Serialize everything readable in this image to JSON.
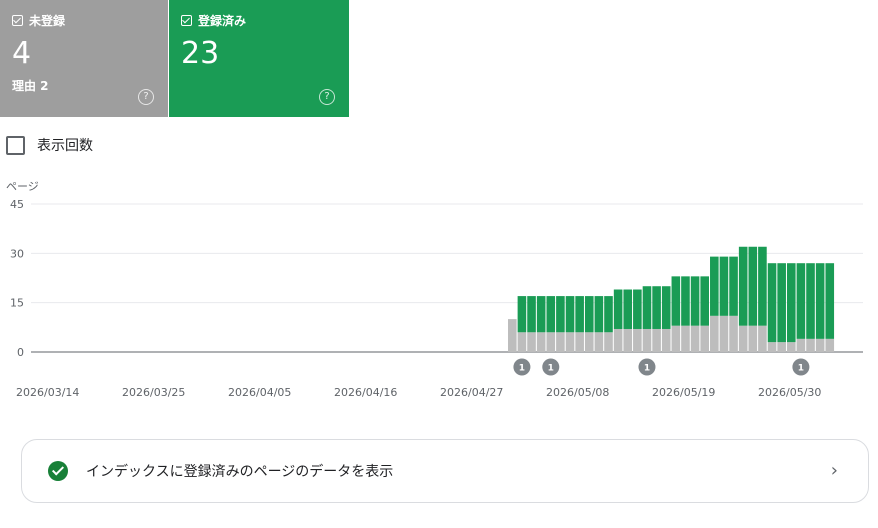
{
  "cards": {
    "unindexed": {
      "label": "未登録",
      "value": "4",
      "sub": "理由 2",
      "help": "?"
    },
    "indexed": {
      "label": "登録済み",
      "value": "23",
      "help": "?"
    }
  },
  "impressions_toggle": {
    "label": "表示回数"
  },
  "chart_data": {
    "type": "bar",
    "ylabel": "ページ",
    "y_ticks": [
      "45",
      "30",
      "15",
      "0"
    ],
    "ylim": [
      0,
      45
    ],
    "x_tick_labels": [
      "2026/03/14",
      "2026/03/25",
      "2026/04/05",
      "2026/04/16",
      "2026/04/27",
      "2026/05/08",
      "2026/05/19",
      "2026/05/30"
    ],
    "start_date": "2026/03/14",
    "series": [
      {
        "name": "未登録",
        "color": "#bdbdbd",
        "values": [
          0,
          0,
          0,
          0,
          0,
          0,
          0,
          0,
          0,
          0,
          0,
          0,
          0,
          0,
          0,
          0,
          0,
          0,
          0,
          0,
          0,
          0,
          0,
          0,
          0,
          0,
          0,
          0,
          0,
          0,
          0,
          0,
          0,
          0,
          0,
          0,
          0,
          0,
          0,
          0,
          0,
          0,
          0,
          0,
          0,
          0,
          0,
          0,
          0,
          10,
          6,
          6,
          6,
          6,
          6,
          6,
          6,
          6,
          6,
          6,
          7,
          7,
          7,
          7,
          7,
          7,
          8,
          8,
          8,
          8,
          11,
          11,
          11,
          8,
          8,
          8,
          3,
          3,
          3,
          4,
          4,
          4,
          4
        ]
      },
      {
        "name": "登録済み",
        "color": "#1a9c55",
        "values": [
          0,
          0,
          0,
          0,
          0,
          0,
          0,
          0,
          0,
          0,
          0,
          0,
          0,
          0,
          0,
          0,
          0,
          0,
          0,
          0,
          0,
          0,
          0,
          0,
          0,
          0,
          0,
          0,
          0,
          0,
          0,
          0,
          0,
          0,
          0,
          0,
          0,
          0,
          0,
          0,
          0,
          0,
          0,
          0,
          0,
          0,
          0,
          0,
          0,
          0,
          11,
          11,
          11,
          11,
          11,
          11,
          11,
          11,
          11,
          11,
          12,
          12,
          12,
          13,
          13,
          13,
          15,
          15,
          15,
          15,
          18,
          18,
          18,
          24,
          24,
          24,
          24,
          24,
          24,
          23,
          23,
          23,
          23
        ]
      }
    ],
    "annotations": [
      {
        "day_index": 50,
        "label": "1"
      },
      {
        "day_index": 53,
        "label": "1"
      },
      {
        "day_index": 63,
        "label": "1"
      },
      {
        "day_index": 79,
        "label": "1"
      }
    ],
    "colors": {
      "grid": "#e8eaed",
      "axis": "#5f6368",
      "annotation": "#80868b"
    }
  },
  "footer": {
    "label": "インデックスに登録済みのページのデータを表示",
    "chevron": "›"
  }
}
